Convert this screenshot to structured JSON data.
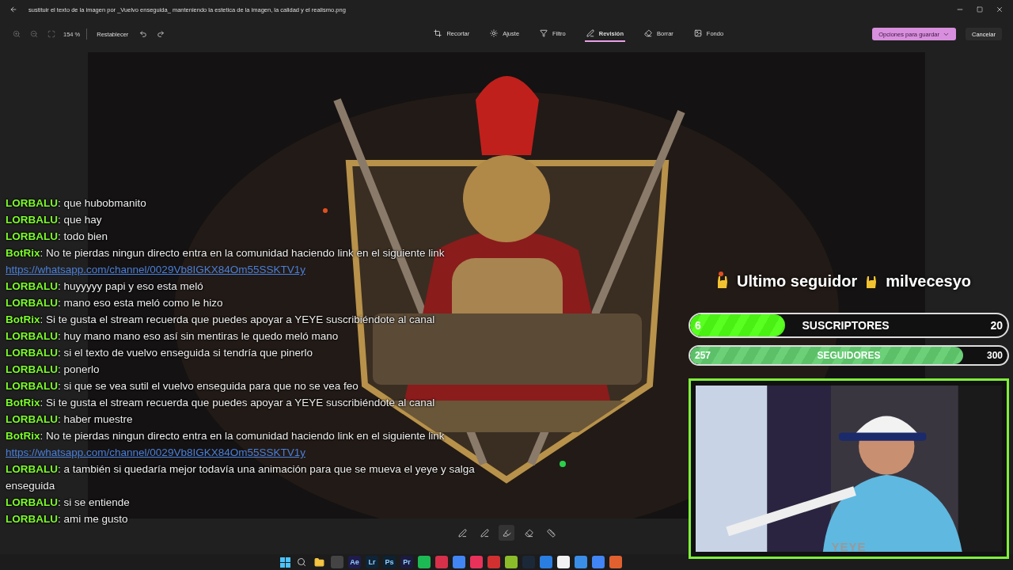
{
  "window": {
    "title": "sustituir el texto de la imagen por _Vuelvo enseguida_ manteniendo la estetica de la imagen, la calidad y el realismo.png"
  },
  "toolbar": {
    "zoom": "154 %",
    "reset": "Restablecer",
    "tools": [
      {
        "label": "Recortar",
        "kind": "crop",
        "selected": false
      },
      {
        "label": "Ajuste",
        "kind": "adjust",
        "selected": false
      },
      {
        "label": "Filtro",
        "kind": "filter",
        "selected": false
      },
      {
        "label": "Revisión",
        "kind": "markup",
        "selected": true
      },
      {
        "label": "Borrar",
        "kind": "erase",
        "selected": false
      },
      {
        "label": "Fondo",
        "kind": "background",
        "selected": false
      }
    ],
    "save_button": "Opciones para guardar",
    "cancel_button": "Cancelar"
  },
  "chat": [
    {
      "kind": "message",
      "user": "LORBALU",
      "sep": ": ",
      "text": "que hubobmanito"
    },
    {
      "kind": "message",
      "user": "LORBALU",
      "sep": ": ",
      "text": "que hay"
    },
    {
      "kind": "message",
      "user": "LORBALU",
      "sep": ": ",
      "text": "todo bien"
    },
    {
      "kind": "message",
      "user": "BotRix",
      "sep": ": ",
      "text": "No te pierdas ningun directo entra en la comunidad haciendo link en el siguiente link"
    },
    {
      "kind": "link",
      "text": "https://whatsapp.com/channel/0029Vb8IGKX84Om55SSKTV1y"
    },
    {
      "kind": "message",
      "user": "LORBALU",
      "sep": ": ",
      "text": "huyyyyy papi y eso esta meló"
    },
    {
      "kind": "message",
      "user": "LORBALU",
      "sep": ": ",
      "text": "mano eso esta meló como le hizo"
    },
    {
      "kind": "message",
      "user": "BotRix",
      "sep": ": ",
      "text": "Si te gusta el stream recuerda que puedes apoyar a YEYE suscribiéndote al canal"
    },
    {
      "kind": "message",
      "user": "LORBALU",
      "sep": ": ",
      "text": "huy mano mano eso así sin mentiras le quedo meló mano"
    },
    {
      "kind": "message",
      "user": "LORBALU",
      "sep": ": ",
      "text": "si el texto de vuelvo enseguida si tendría que pinerlo"
    },
    {
      "kind": "message",
      "user": "LORBALU",
      "sep": ": ",
      "text": "ponerlo"
    },
    {
      "kind": "message",
      "user": "LORBALU",
      "sep": ": ",
      "text": "si que se vea sutil el vuelvo enseguida para que no se vea feo"
    },
    {
      "kind": "message",
      "user": "BotRix",
      "sep": ": ",
      "text": "Si te gusta el stream recuerda que puedes apoyar a YEYE suscribiéndote al canal"
    },
    {
      "kind": "message",
      "user": "LORBALU",
      "sep": ": ",
      "text": "haber muestre"
    },
    {
      "kind": "message",
      "user": "BotRix",
      "sep": ": ",
      "text": "No te pierdas ningun directo entra en la comunidad haciendo link en el siguiente link"
    },
    {
      "kind": "link",
      "text": "https://whatsapp.com/channel/0029Vb8IGKX84Om55SSKTV1y"
    },
    {
      "kind": "message",
      "user": "LORBALU",
      "sep": ": ",
      "text": "a también si quedaría mejor todavía una animación para que se mueva el yeye y salga enseguida"
    },
    {
      "kind": "message",
      "user": "LORBALU",
      "sep": ": ",
      "text": "si se entiende"
    },
    {
      "kind": "message",
      "user": "LORBALU",
      "sep": ": ",
      "text": "ami me gusto"
    }
  ],
  "stream": {
    "last_follower_label": "Ultimo seguidor",
    "last_follower": "milvecesyo",
    "goals": [
      {
        "label": "SUSCRIPTORES",
        "current": "6",
        "target": "20",
        "level": 0.3,
        "kind": "bright"
      },
      {
        "label": "SEGUIDORES",
        "current": "257",
        "target": "300",
        "level": 0.86,
        "kind": "soft"
      }
    ],
    "webcam_label": "YEYE"
  },
  "markup_tools": [
    {
      "selected": false
    },
    {
      "selected": false
    },
    {
      "selected": true
    },
    {
      "selected": false
    },
    {
      "selected": false
    }
  ],
  "taskbar": [
    {
      "kind": "windows"
    },
    {
      "kind": "search"
    },
    {
      "kind": "folder"
    },
    {
      "kind": "app",
      "color": "#444444"
    },
    {
      "kind": "app",
      "color": "#1f1b4d",
      "label": "Ae"
    },
    {
      "kind": "app",
      "color": "#0f2437",
      "label": "Lr"
    },
    {
      "kind": "app",
      "color": "#0d2233",
      "label": "Ps"
    },
    {
      "kind": "app",
      "color": "#1d1a40",
      "label": "Pr"
    },
    {
      "kind": "app",
      "color": "#1db954"
    },
    {
      "kind": "app",
      "color": "#d6304a"
    },
    {
      "kind": "app",
      "color": "#4285f4"
    },
    {
      "kind": "app",
      "color": "#e8325a"
    },
    {
      "kind": "app",
      "color": "#d03030"
    },
    {
      "kind": "app",
      "color": "#8bbd2a"
    },
    {
      "kind": "app",
      "color": "#1b2838"
    },
    {
      "kind": "app",
      "color": "#2a7de1"
    },
    {
      "kind": "app",
      "color": "#f2f2f2"
    },
    {
      "kind": "app",
      "color": "#3a8ee6"
    },
    {
      "kind": "app",
      "color": "#4285f4"
    },
    {
      "kind": "app",
      "color": "#e06030"
    }
  ]
}
